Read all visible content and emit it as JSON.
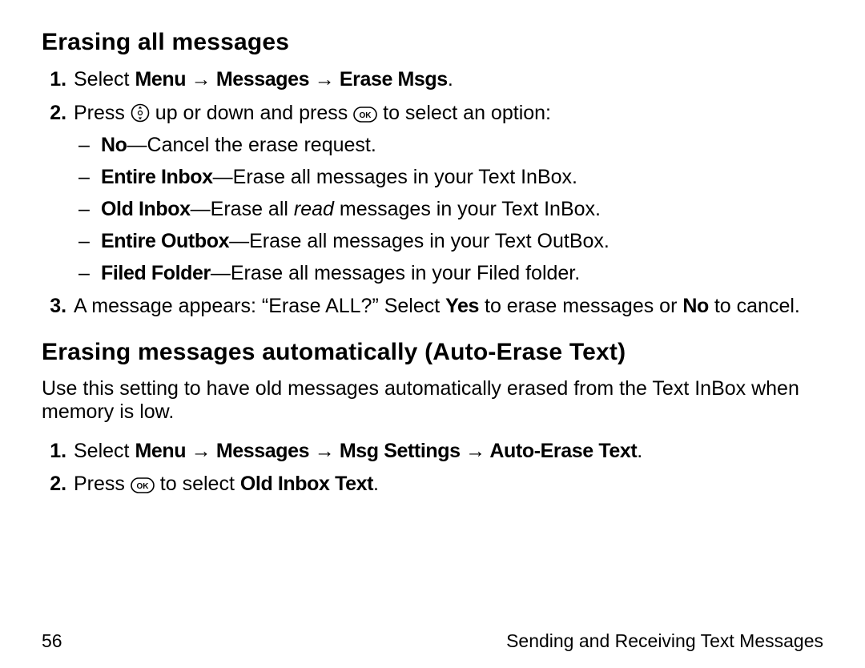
{
  "section1": {
    "heading": "Erasing all messages",
    "step1_prefix": "Select ",
    "step1_path": [
      "Menu",
      "Messages",
      "Erase Msgs"
    ],
    "step1_suffix": ".",
    "step2_prefix": "Press ",
    "step2_mid": " up or down and press ",
    "step2_suffix": " to select an option:",
    "bullets": [
      {
        "label": "No",
        "desc": "—Cancel the erase request."
      },
      {
        "label": "Entire Inbox",
        "desc_pre": "—Erase all messages in your Text InBox."
      },
      {
        "label": "Old Inbox",
        "desc_pre": "—Erase all ",
        "desc_em": "read",
        "desc_post": " messages in your Text InBox."
      },
      {
        "label": "Entire Outbox",
        "desc_pre": "—Erase all messages in your Text OutBox."
      },
      {
        "label": "Filed Folder",
        "desc_pre": "—Erase all messages in your Filed folder."
      }
    ],
    "step3_prefix": "A message appears: “Erase ALL?” Select ",
    "step3_yes": "Yes",
    "step3_mid": " to erase messages or ",
    "step3_no": "No",
    "step3_suffix": " to cancel."
  },
  "section2": {
    "heading": "Erasing messages automatically (Auto-Erase Text)",
    "intro": "Use this setting to have old messages automatically erased from the Text InBox when memory is low.",
    "step1_prefix": "Select ",
    "step1_path": [
      "Menu",
      "Messages",
      "Msg Settings",
      "Auto-Erase Text"
    ],
    "step1_suffix": ".",
    "step2_prefix": "Press ",
    "step2_mid": " to select ",
    "step2_bold": "Old Inbox Text",
    "step2_suffix": "."
  },
  "footer": {
    "page": "56",
    "chapter": "Sending and Receiving Text Messages"
  },
  "arrow": "→"
}
